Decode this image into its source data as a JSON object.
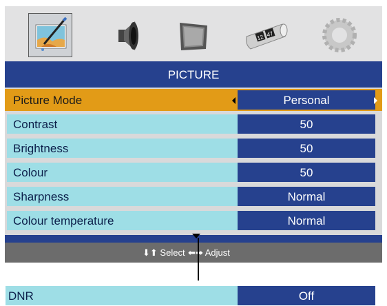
{
  "menu": {
    "tabs": [
      {
        "icon": "picture-icon",
        "selected": true
      },
      {
        "icon": "speaker-icon",
        "selected": false
      },
      {
        "icon": "monitor-icon",
        "selected": false
      },
      {
        "icon": "clock-icon",
        "selected": false
      },
      {
        "icon": "gear-icon",
        "selected": false
      }
    ],
    "clock_digits": [
      "12",
      "47"
    ],
    "title": "PICTURE",
    "rows": [
      {
        "label": "Picture Mode",
        "value": "Personal"
      },
      {
        "label": "Contrast",
        "value": "50"
      },
      {
        "label": "Brightness",
        "value": "50"
      },
      {
        "label": "Colour",
        "value": "50"
      },
      {
        "label": "Sharpness",
        "value": "Normal"
      },
      {
        "label": "Colour temperature",
        "value": "Normal"
      }
    ],
    "footer": {
      "select_hint": "Select",
      "adjust_hint": "Adjust"
    }
  },
  "extra_row": {
    "label": "DNR",
    "value": "Off"
  },
  "colors": {
    "highlight": "#e29b17",
    "value_bg": "#26418e",
    "label_bg": "#9edee6"
  }
}
